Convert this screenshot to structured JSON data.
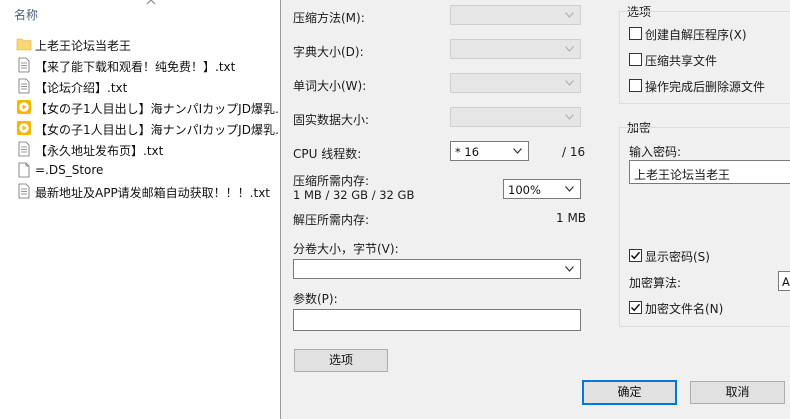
{
  "explorer": {
    "column_name_label": "名称",
    "files": [
      {
        "name": "上老王论坛当老王",
        "icon": "folder-icon"
      },
      {
        "name": "【来了能下载和观看！纯免费！】.txt",
        "icon": "text-file-icon"
      },
      {
        "name": "【论坛介绍】.txt",
        "icon": "text-file-icon"
      },
      {
        "name": "【女の子1人目出し】海ナンパIカップJD爆乳…",
        "icon": "video-file-icon"
      },
      {
        "name": "【女の子1人目出し】海ナンパIカップJD爆乳…",
        "icon": "video-file-icon"
      },
      {
        "name": "【永久地址发布页】.txt",
        "icon": "text-file-icon"
      },
      {
        "name": "=.DS_Store",
        "icon": "blank-file-icon"
      },
      {
        "name": "最新地址及APP请发邮箱自动获取！！！.txt",
        "icon": "text-file-icon"
      }
    ]
  },
  "dialog": {
    "compression_method_label": "压缩方法(M):",
    "dictionary_size_label": "字典大小(D):",
    "word_size_label": "单词大小(W):",
    "solid_block_label": "固实数据大小:",
    "cpu_threads_label": "CPU 线程数:",
    "cpu_threads_value": "* 16",
    "cpu_threads_total": "/ 16",
    "compress_memory_label": "压缩所需内存:",
    "compress_memory_value": "1 MB / 32 GB / 32 GB",
    "memory_percent_value": "100%",
    "decompress_memory_label": "解压所需内存:",
    "decompress_memory_value": "1 MB",
    "split_volume_label": "分卷大小，字节(V):",
    "parameters_label": "参数(P):",
    "options_button": "选项",
    "options_group": {
      "title": "选项",
      "items": [
        {
          "label": "创建自解压程序(X)",
          "checked": false
        },
        {
          "label": "压缩共享文件",
          "checked": false
        },
        {
          "label": "操作完成后删除源文件",
          "checked": false
        }
      ]
    },
    "encryption_group": {
      "title": "加密",
      "password_label": "输入密码:",
      "password_value": "上老王论坛当老王",
      "show_password_label": "显示密码(S)",
      "show_password_checked": true,
      "algorithm_label": "加密算法:",
      "algorithm_value": "A",
      "encrypt_filenames_label": "加密文件名(N)",
      "encrypt_filenames_checked": true
    },
    "ok_button": "确定",
    "cancel_button": "取消"
  },
  "colors": {
    "accent": "#0078d7",
    "folder": "#f8d775",
    "video": "#f5b800",
    "dialog_bg": "#f0f0f0"
  }
}
